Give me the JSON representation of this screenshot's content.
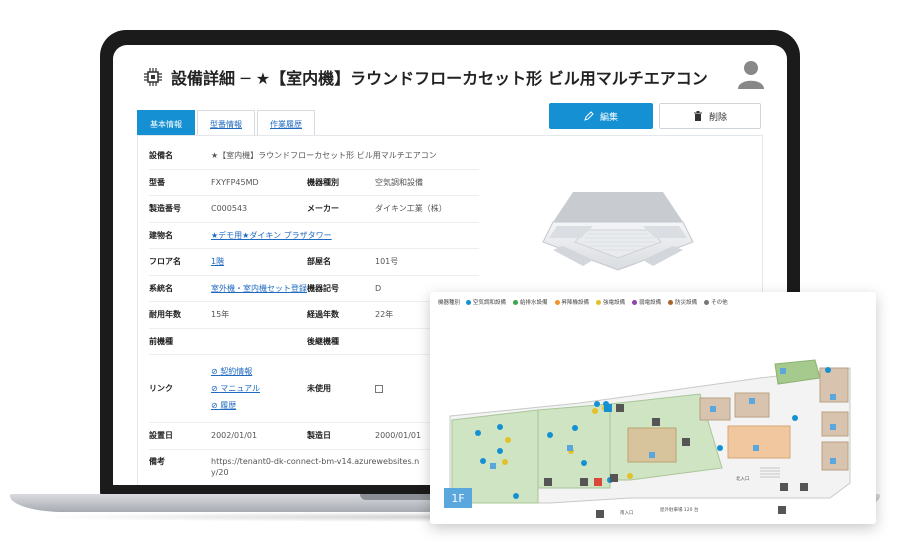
{
  "header": {
    "title": "設備詳細 ─ ★【室内機】ラウンドフローカセット形 ビル用マルチエアコン"
  },
  "tabs": [
    {
      "label": "基本情報",
      "active": true
    },
    {
      "label": "型番情報",
      "active": false
    },
    {
      "label": "作業履歴",
      "active": false
    }
  ],
  "actions": {
    "edit_label": "編集",
    "delete_label": "削除"
  },
  "details": {
    "equipment_name": {
      "label": "設備名",
      "value": "★【室内機】ラウンドフローカセット形 ビル用マルチエアコン"
    },
    "model": {
      "label": "型番",
      "value": "FXYFP45MD"
    },
    "equipment_type": {
      "label": "機器種別",
      "value": "空気調和設備"
    },
    "serial": {
      "label": "製造番号",
      "value": "C000543"
    },
    "maker": {
      "label": "メーカー",
      "value": "ダイキン工業（株）"
    },
    "building": {
      "label": "建物名",
      "value": "★デモ用★ダイキン プラザタワー"
    },
    "floor": {
      "label": "フロア名",
      "value": "1階"
    },
    "room": {
      "label": "部屋名",
      "value": "101号"
    },
    "system": {
      "label": "系統名",
      "value": "室外機・室内機セット登録"
    },
    "device_code": {
      "label": "機器記号",
      "value": "D"
    },
    "service_life": {
      "label": "耐用年数",
      "value": "15年"
    },
    "elapsed": {
      "label": "経過年数",
      "value": "22年"
    },
    "predecessor": {
      "label": "前機種",
      "value": ""
    },
    "successor": {
      "label": "後継機種",
      "value": ""
    },
    "links": {
      "label": "リンク",
      "items": [
        "契約情報",
        "マニュアル",
        "履歴"
      ]
    },
    "unused": {
      "label": "未使用",
      "checked": false
    },
    "install_date": {
      "label": "設置日",
      "value": "2002/01/01"
    },
    "manufacture_date": {
      "label": "製造日",
      "value": "2000/01/01"
    },
    "notes": {
      "label": "備考",
      "value": "https://tenant0-dk-connect-bm-v14.azurewebsites.n",
      "value2": "y/20"
    }
  },
  "map": {
    "legend_title": "機器種別",
    "legend": [
      {
        "label": "空気調和設備",
        "color": "#1591d3"
      },
      {
        "label": "給排水設備",
        "color": "#3aa54a"
      },
      {
        "label": "昇降機設備",
        "color": "#f0932b"
      },
      {
        "label": "強電設備",
        "color": "#e3c02a"
      },
      {
        "label": "弱電設備",
        "color": "#8e44ad"
      },
      {
        "label": "防災設備",
        "color": "#a8652b"
      },
      {
        "label": "その他",
        "color": "#777777"
      }
    ],
    "floor_label": "1F",
    "entrance_label": "南入口",
    "parking_label": "屋外駐車場 120 台",
    "north_entrance_label": "北入口"
  }
}
